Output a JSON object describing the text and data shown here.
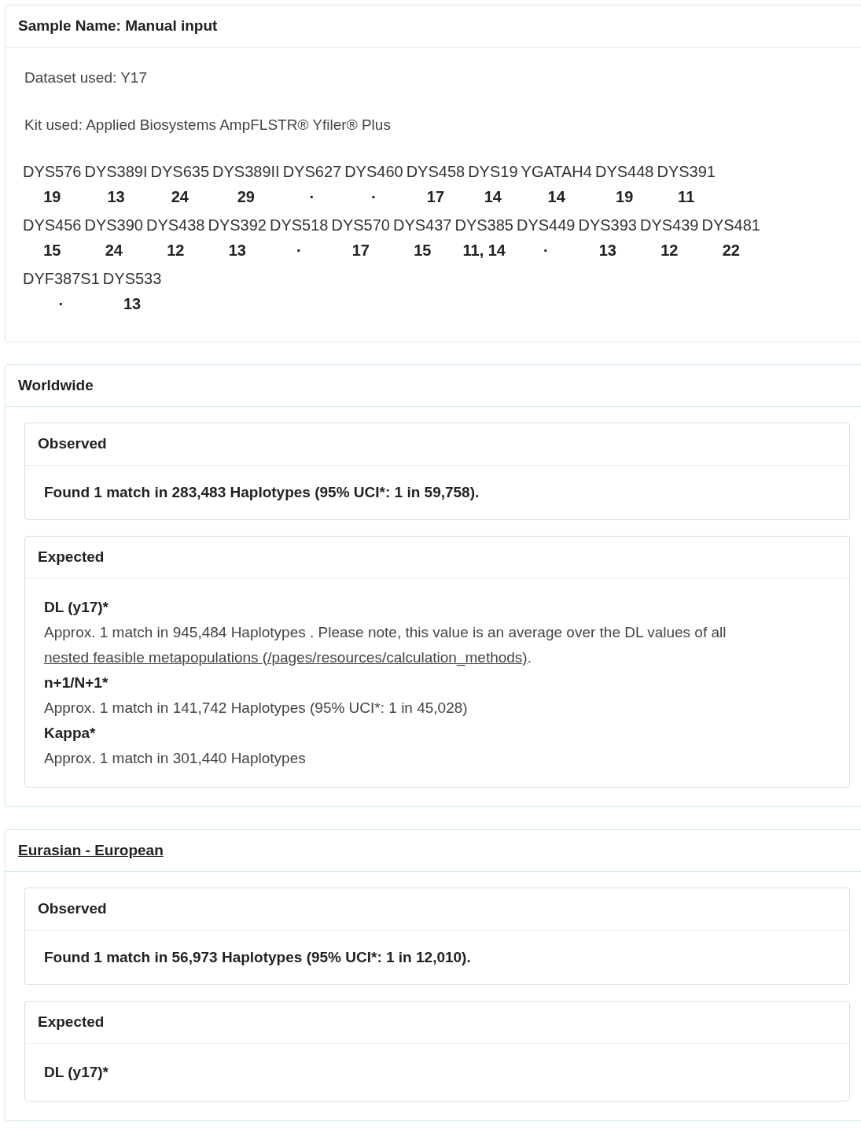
{
  "sample": {
    "title": "Sample Name: Manual input",
    "dataset": "Dataset used: Y17",
    "kit": "Kit used: Applied Biosystems AmpFLSTR® Yfiler® Plus",
    "loci_rows": [
      [
        {
          "name": "DYS576",
          "value": "19"
        },
        {
          "name": "DYS389I",
          "value": "13"
        },
        {
          "name": "DYS635",
          "value": "24"
        },
        {
          "name": "DYS389II",
          "value": "29"
        },
        {
          "name": "DYS627",
          "value": "·"
        },
        {
          "name": "DYS460",
          "value": "·"
        },
        {
          "name": "DYS458",
          "value": "17"
        },
        {
          "name": "DYS19",
          "value": "14"
        },
        {
          "name": "YGATAH4",
          "value": "14"
        },
        {
          "name": "DYS448",
          "value": "19"
        },
        {
          "name": "DYS391",
          "value": "11"
        }
      ],
      [
        {
          "name": "DYS456",
          "value": "15"
        },
        {
          "name": "DYS390",
          "value": "24"
        },
        {
          "name": "DYS438",
          "value": "12"
        },
        {
          "name": "DYS392",
          "value": "13"
        },
        {
          "name": "DYS518",
          "value": "·"
        },
        {
          "name": "DYS570",
          "value": "17"
        },
        {
          "name": "DYS437",
          "value": "15"
        },
        {
          "name": "DYS385",
          "value": "11, 14"
        },
        {
          "name": "DYS449",
          "value": "·"
        },
        {
          "name": "DYS393",
          "value": "13"
        },
        {
          "name": "DYS439",
          "value": "12"
        },
        {
          "name": "DYS481",
          "value": "22"
        }
      ],
      [
        {
          "name": "DYF387S1",
          "value": "·"
        },
        {
          "name": "DYS533",
          "value": "13"
        }
      ]
    ]
  },
  "populations": [
    {
      "title": "Worldwide",
      "linked": false,
      "observed": {
        "title": "Observed",
        "text": "Found 1 match in 283,483 Haplotypes (95% UCI*: 1 in 59,758)."
      },
      "expected": {
        "title": "Expected",
        "items": [
          {
            "label": "DL (y17)*",
            "text": "Approx. 1 match in 945,484 Haplotypes . Please note, this value is an average over the DL values of all",
            "link": "nested feasible metapopulations (/pages/resources/calculation_methods)",
            "after": "."
          },
          {
            "label": "n+1/N+1*",
            "text": "Approx. 1 match in 141,742 Haplotypes (95% UCI*: 1 in 45,028)"
          },
          {
            "label": "Kappa*",
            "text": "Approx. 1 match in 301,440 Haplotypes"
          }
        ]
      }
    },
    {
      "title": "Eurasian - European",
      "linked": true,
      "observed": {
        "title": "Observed",
        "text": "Found 1 match in 56,973 Haplotypes (95% UCI*: 1 in 12,010)."
      },
      "expected": {
        "title": "Expected",
        "items": [
          {
            "label": "DL (y17)*"
          }
        ]
      }
    }
  ]
}
